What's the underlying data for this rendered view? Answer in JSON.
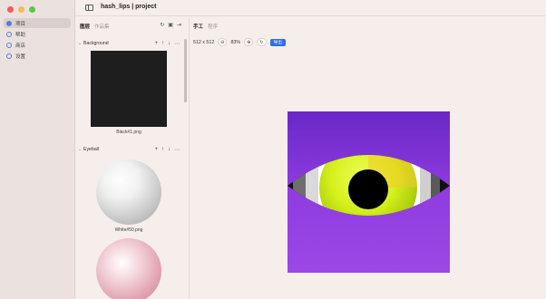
{
  "window": {
    "title": "hash_lips | project"
  },
  "sidebar": {
    "items": [
      {
        "label": "项目",
        "icon": "folder-icon",
        "active": true
      },
      {
        "label": "帮助",
        "icon": "help-icon",
        "active": false
      },
      {
        "label": "商店",
        "icon": "store-icon",
        "active": false
      },
      {
        "label": "设置",
        "icon": "gear-icon",
        "active": false
      }
    ]
  },
  "layers_panel": {
    "tabs": [
      {
        "label": "图层",
        "active": true
      },
      {
        "label": "作品集",
        "active": false
      }
    ],
    "groups": [
      {
        "name": "Background",
        "collapse_glyph": "⌄",
        "thumbnail": {
          "label": "Black#1.png",
          "type": "black-square"
        }
      },
      {
        "name": "Eyeball",
        "collapse_glyph": "⌄",
        "thumbnails": [
          {
            "label": "White#50.png",
            "type": "white-sphere"
          },
          {
            "label": "",
            "type": "pink-sphere"
          }
        ]
      }
    ],
    "group_actions": {
      "add": "+",
      "up": "↑",
      "down": "↓",
      "more": "⋯"
    }
  },
  "main": {
    "tabs": [
      {
        "label": "手工",
        "active": true
      },
      {
        "label": "程序",
        "active": false
      }
    ],
    "toolbar": {
      "size": "512 x 512",
      "zoom_out": "⊖",
      "zoom": "83%",
      "zoom_in": "⊕",
      "reset": "↻",
      "export": "导出"
    }
  },
  "colors": {
    "accent": "#2f6fe2",
    "canvas_bg": "#8a35d8",
    "iris": "#d7f21f",
    "pupil": "#000000"
  }
}
